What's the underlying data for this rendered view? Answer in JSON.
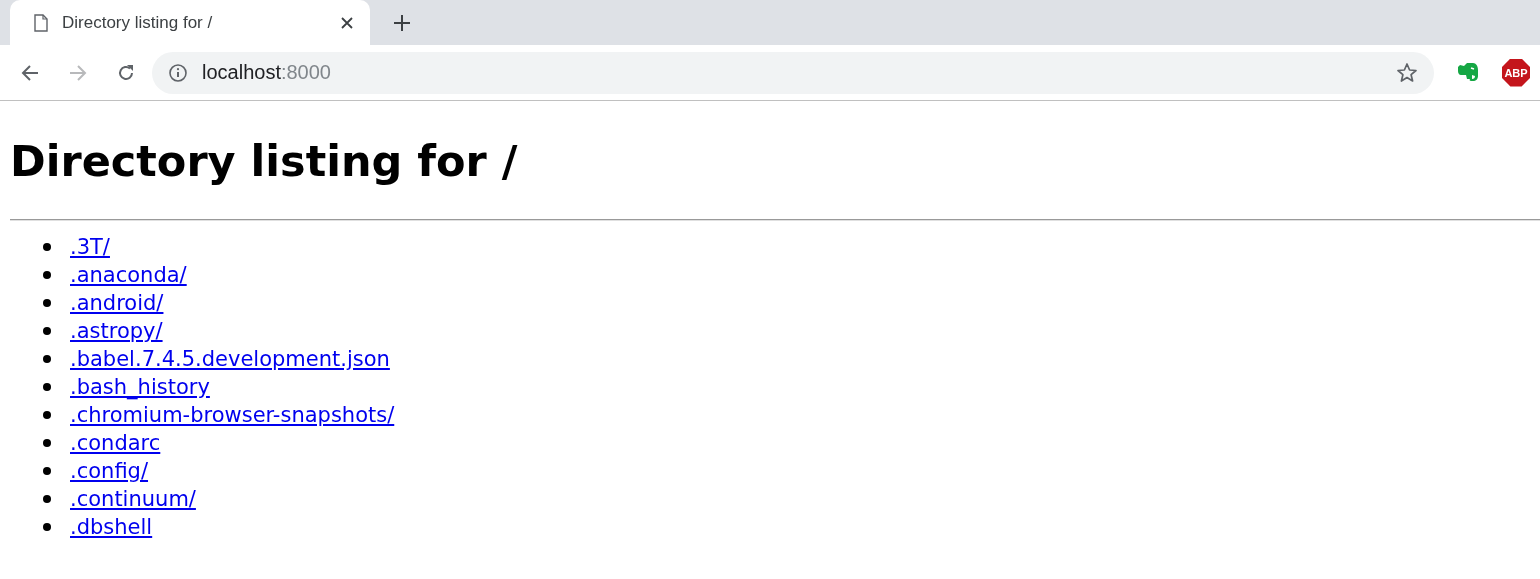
{
  "tabs": [
    {
      "title": "Directory listing for /",
      "selected": true
    }
  ],
  "toolbar": {
    "back_disabled": false,
    "forward_disabled": true,
    "address": {
      "host": "localhost",
      "port": ":8000"
    },
    "extensions": [
      {
        "kind": "elephant"
      },
      {
        "kind": "stop",
        "label": "ABP"
      }
    ]
  },
  "page": {
    "heading": "Directory listing for /",
    "links": [
      ".3T/",
      ".anaconda/",
      ".android/",
      ".astropy/",
      ".babel.7.4.5.development.json",
      ".bash_history",
      ".chromium-browser-snapshots/",
      ".condarc",
      ".config/",
      ".continuum/",
      ".dbshell"
    ]
  }
}
